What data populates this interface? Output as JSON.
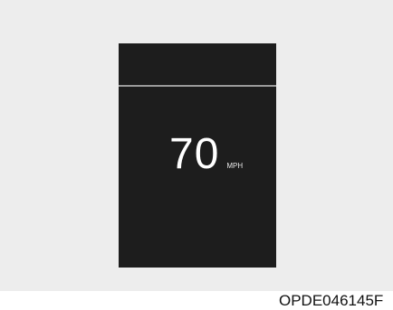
{
  "display": {
    "speed_value": "70",
    "speed_unit": "MPH"
  },
  "figure": {
    "code": "OPDE046145F"
  },
  "colors": {
    "background_panel": "#ededed",
    "display_background": "#1d1d1d",
    "divider": "#9a9a9a",
    "text_on_display": "#ffffff"
  }
}
